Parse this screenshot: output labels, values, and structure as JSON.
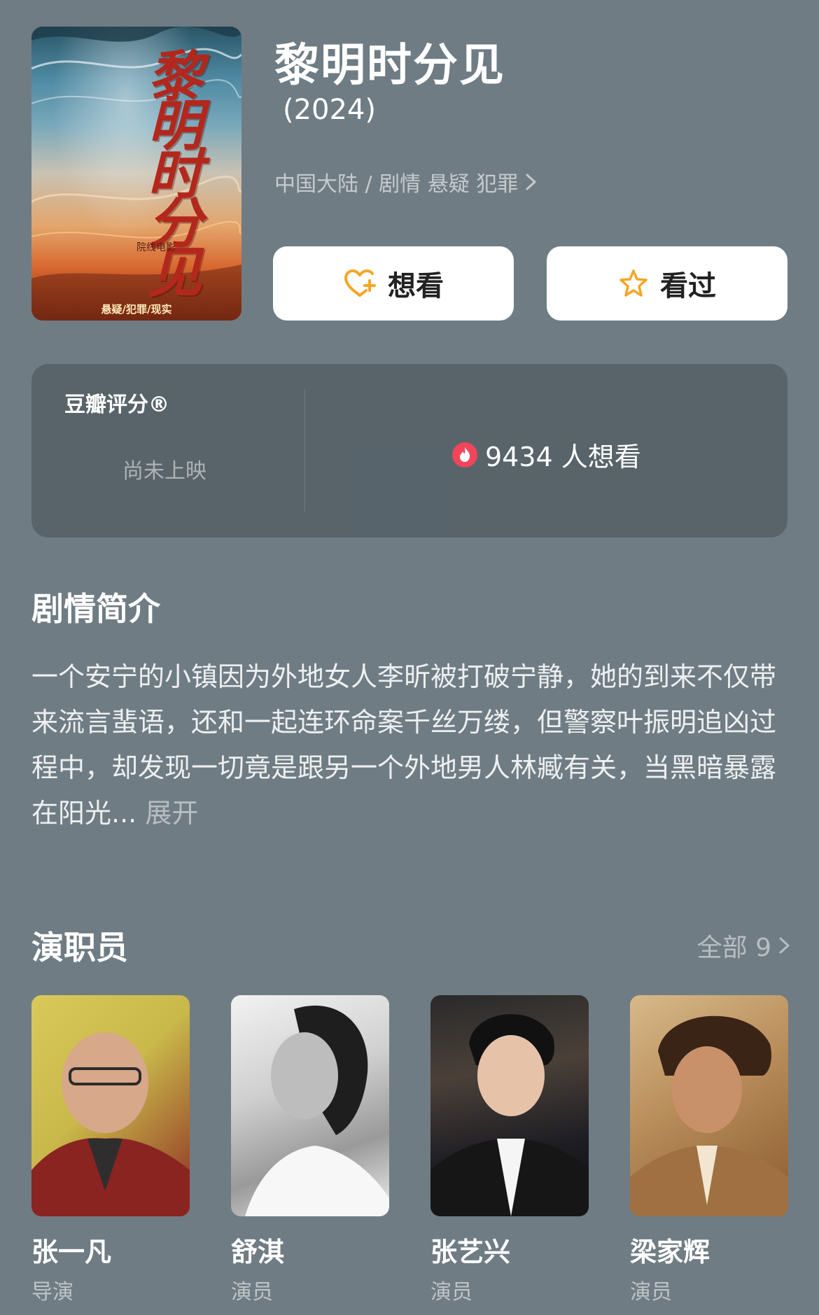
{
  "movie": {
    "title": "黎明时分见",
    "year": "(2024)",
    "meta": "中国大陆 / 剧情 悬疑 犯罪",
    "poster": {
      "title": "黎明时分见",
      "subtitle": "院线电影",
      "tags": "悬疑/犯罪/现实"
    }
  },
  "actions": {
    "want_label": "想看",
    "seen_label": "看过"
  },
  "rating": {
    "label": "豆瓣评分®",
    "status": "尚未上映",
    "want_count": "9434 人想看"
  },
  "synopsis": {
    "heading": "剧情简介",
    "text": "一个安宁的小镇因为外地女人李昕被打破宁静，她的到来不仅带来流言蜚语，还和一起连环命案千丝万缕，但警察叶振明追凶过程中，却发现一切竟是跟另一个外地男人林臧有关，当黑暗暴露在阳光...",
    "expand_label": "展开"
  },
  "cast": {
    "heading": "演职员",
    "all_label": "全部 9",
    "members": [
      {
        "name": "张一凡",
        "role": "导演"
      },
      {
        "name": "舒淇",
        "role": "演员"
      },
      {
        "name": "张艺兴",
        "role": "演员"
      },
      {
        "name": "梁家辉",
        "role": "演员"
      }
    ]
  },
  "icons": {
    "want": "heart-plus-icon",
    "seen": "star-icon",
    "hot": "flame-icon",
    "chevron": "chevron-right-icon"
  },
  "colors": {
    "background": "#6f7c84",
    "accent": "#f5a623",
    "hot": "#f2455c"
  }
}
